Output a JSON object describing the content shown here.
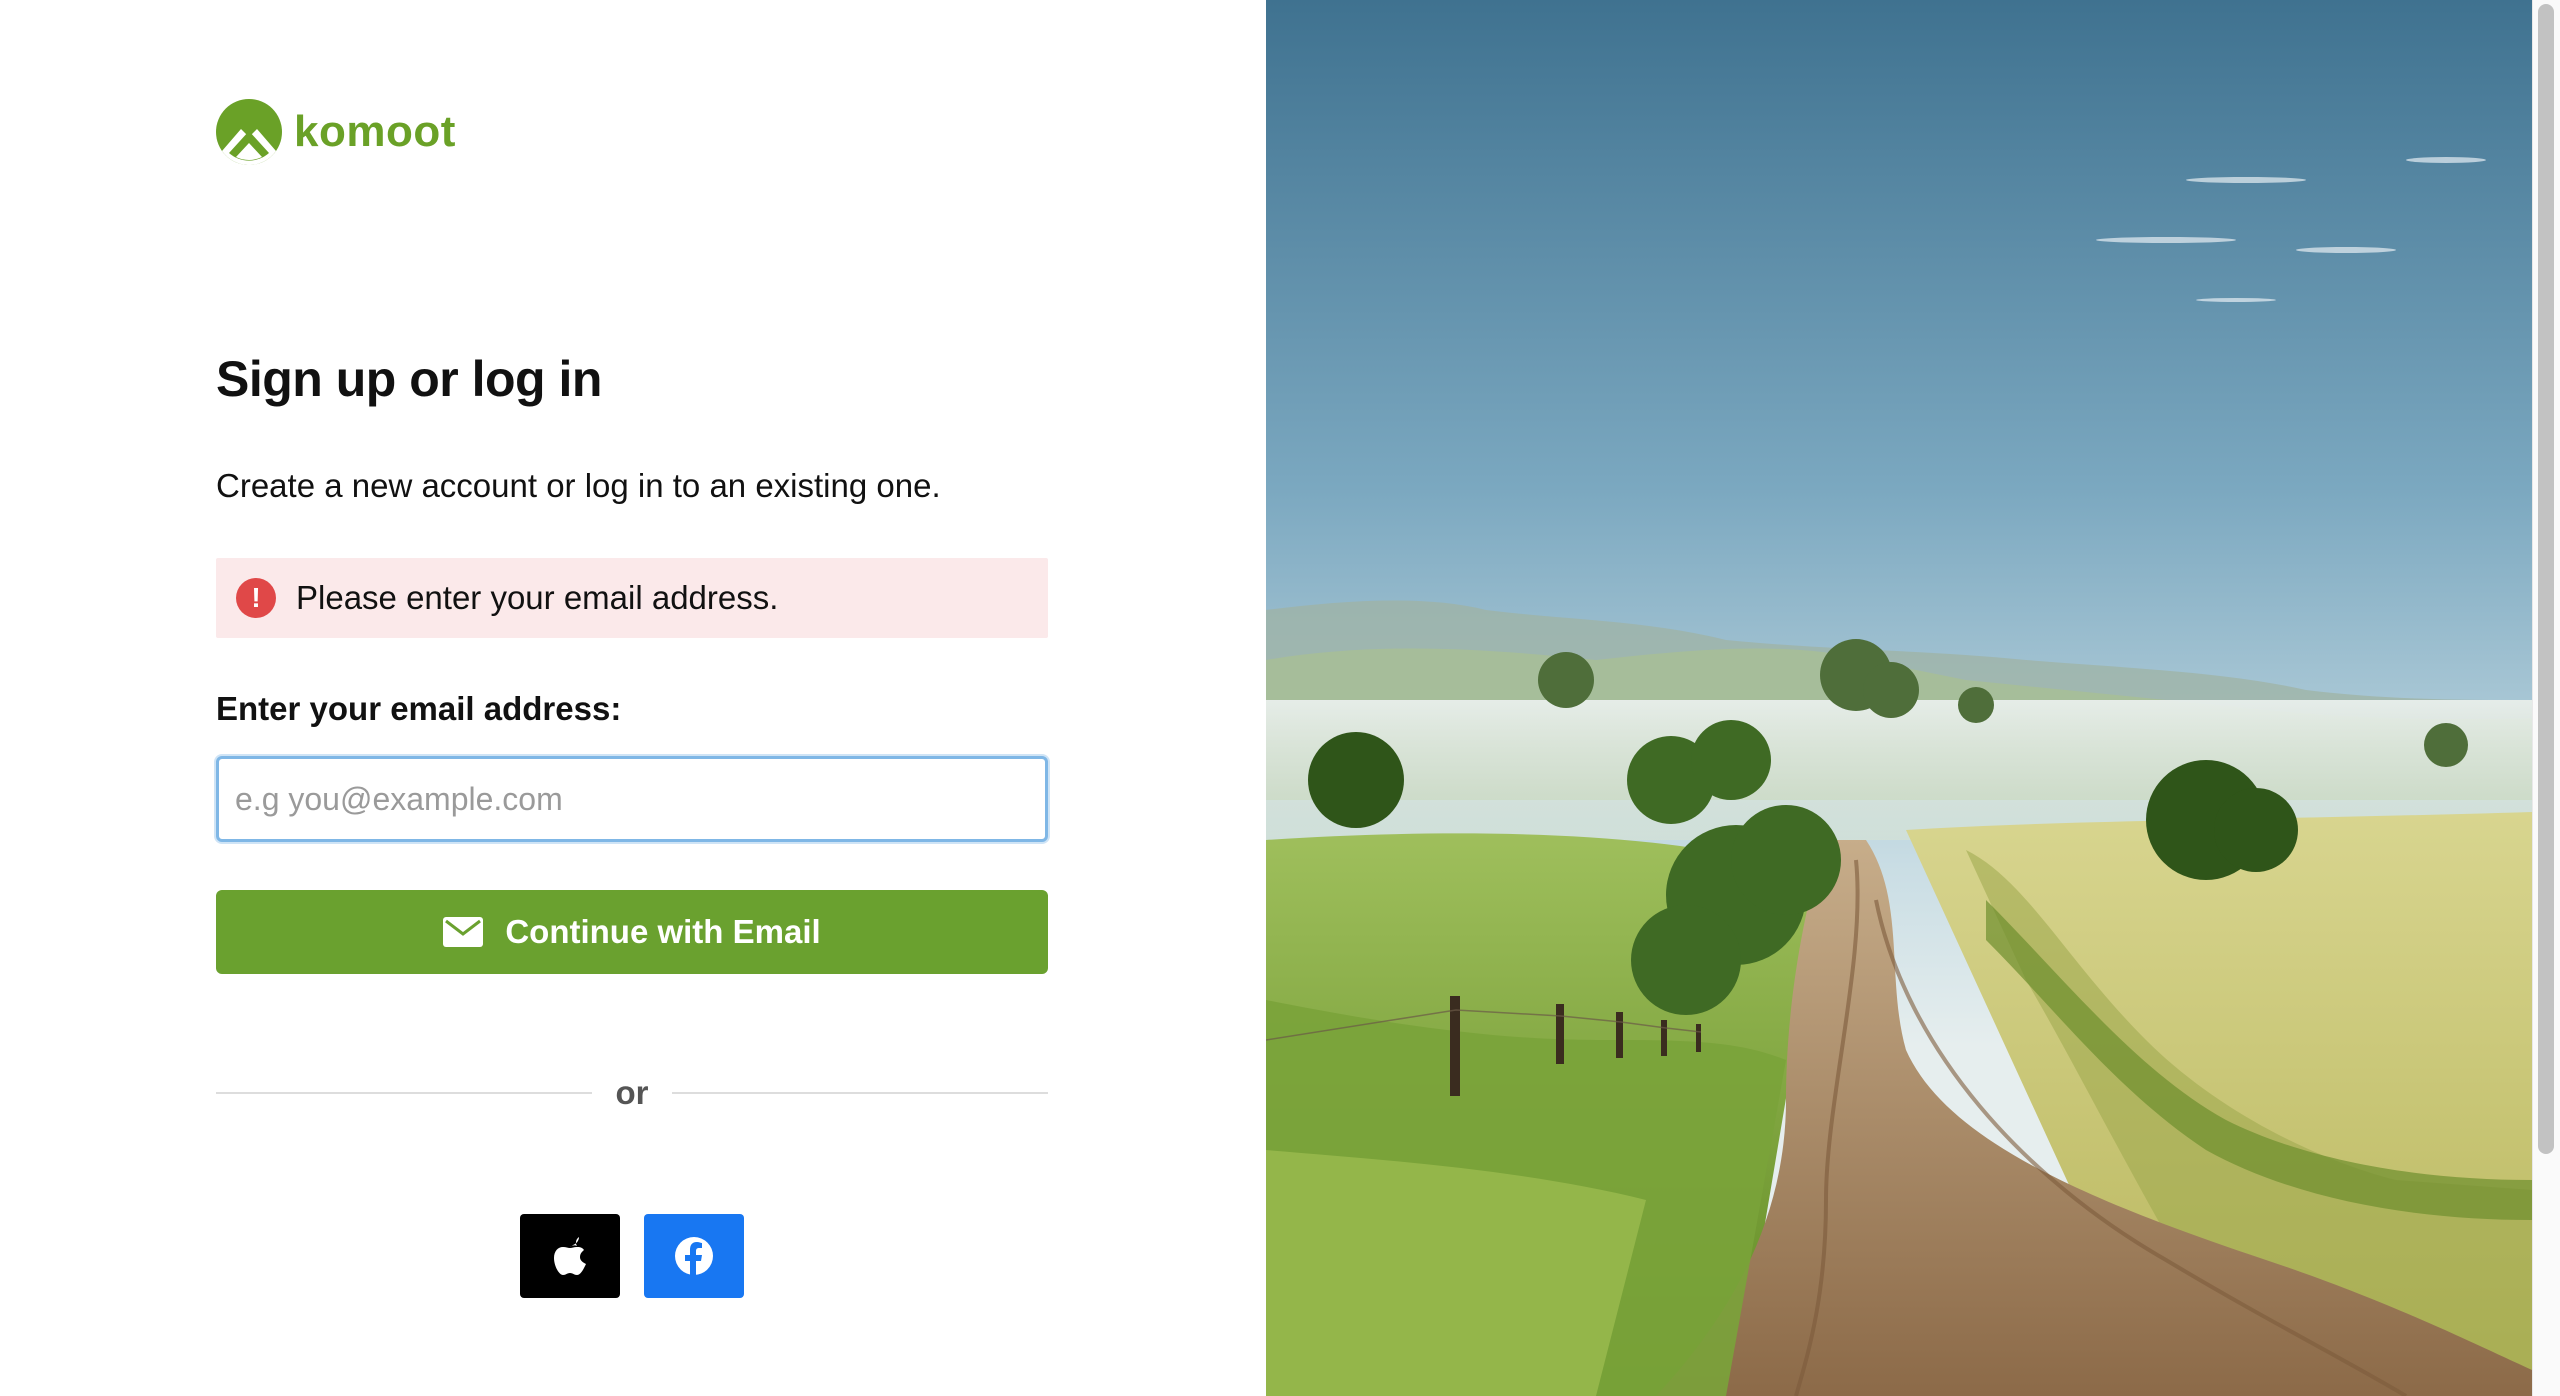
{
  "brand": {
    "name": "komoot",
    "color": "#6aa127"
  },
  "auth": {
    "title": "Sign up or log in",
    "subtitle": "Create a new account or log in to an existing one.",
    "error_icon": "exclamation-circle-icon",
    "error_message": "Please enter your email address.",
    "email_label": "Enter your email address:",
    "email_value": "",
    "email_placeholder": "e.g you@example.com",
    "continue_icon": "envelope-icon",
    "continue_label": "Continue with Email",
    "divider_text": "or",
    "social": [
      {
        "provider": "apple",
        "icon": "apple-icon",
        "color": "#000000"
      },
      {
        "provider": "facebook",
        "icon": "facebook-icon",
        "color": "#1877f2"
      }
    ]
  },
  "hero_image": {
    "subject": "landscape-photo",
    "accent_colors": [
      "#4a7f9c",
      "#7aa646",
      "#b9966e"
    ]
  }
}
